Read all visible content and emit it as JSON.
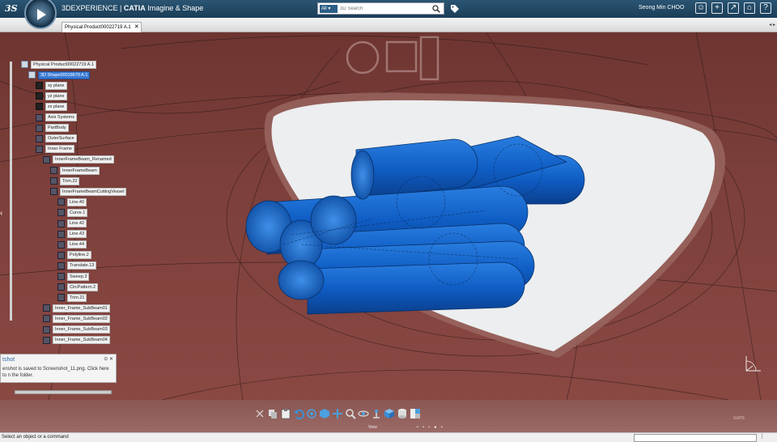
{
  "topbar": {
    "brand": "3DEXPERIENCE | CATIA Imagine & Shape",
    "brand_prefix": "3DEXPERIENCE | ",
    "brand_app": "CATIA",
    "brand_suffix": " Imagine & Shape",
    "search_scope": "All ▾",
    "search_placeholder": "3D Search",
    "user": "Seong Min CHOO",
    "ds_logo": "3S"
  },
  "tabs": [
    {
      "label": "Physical Product00022719 A.1"
    }
  ],
  "tree": {
    "items": [
      {
        "label": "Physical Product00022719 A.1",
        "level": 0,
        "icon": "product-icon"
      },
      {
        "label": "3D Shape00018679 A.1",
        "level": 1,
        "icon": "part-icon",
        "selected": true
      },
      {
        "label": "xy plane",
        "level": 2,
        "icon": "plane-icon"
      },
      {
        "label": "yz plane",
        "level": 2,
        "icon": "plane-icon"
      },
      {
        "label": "zx plane",
        "level": 2,
        "icon": "plane-icon"
      },
      {
        "label": "Axis Systems",
        "level": 2,
        "icon": "axis-system-icon"
      },
      {
        "label": "PartBody",
        "level": 2,
        "icon": "body-icon"
      },
      {
        "label": "OuterSurface",
        "level": 2,
        "icon": "geoset-icon"
      },
      {
        "label": "Inner Frame",
        "level": 2,
        "icon": "geoset-icon"
      },
      {
        "label": "InnerFrameBeam_Renamed",
        "level": 3,
        "icon": "geoset-icon"
      },
      {
        "label": "InnerFrameBeam",
        "level": 4,
        "icon": "surface-icon"
      },
      {
        "label": "Trim.22",
        "level": 4,
        "icon": "trim-icon"
      },
      {
        "label": "InnerFrameBeamCuttingVessel",
        "level": 4,
        "icon": "geoset-icon"
      },
      {
        "label": "Line.40",
        "level": 5,
        "icon": "line-icon"
      },
      {
        "label": "Curve.1",
        "level": 5,
        "icon": "curve-icon"
      },
      {
        "label": "Line.42",
        "level": 5,
        "icon": "line-icon"
      },
      {
        "label": "Line.43",
        "level": 5,
        "icon": "line-icon"
      },
      {
        "label": "Line.44",
        "level": 5,
        "icon": "line-icon"
      },
      {
        "label": "Polyline.2",
        "level": 5,
        "icon": "polyline-icon"
      },
      {
        "label": "Translate.13",
        "level": 5,
        "icon": "translate-icon"
      },
      {
        "label": "Sweep.3",
        "level": 5,
        "icon": "sweep-icon"
      },
      {
        "label": "CircPattern.2",
        "level": 5,
        "icon": "pattern-icon"
      },
      {
        "label": "Trim.21",
        "level": 5,
        "icon": "trim-icon"
      },
      {
        "label": "Inner_Frame_SubBeam01",
        "level": 3,
        "icon": "geoset-icon"
      },
      {
        "label": "Inner_Frame_SubBeam02",
        "level": 3,
        "icon": "geoset-icon"
      },
      {
        "label": "Inner_Frame_SubBeam03",
        "level": 3,
        "icon": "geoset-icon"
      },
      {
        "label": "Inner_Frame_SubBeam04",
        "level": 3,
        "icon": "geoset-icon"
      }
    ]
  },
  "notification": {
    "title": "tshot",
    "message": "enshot is saved to Screenshot_11.png. Click here to n the folder.",
    "controls": "⊙ ✕"
  },
  "actionbar": {
    "section_label": "View",
    "page_dots": "• • • ● •",
    "corner_label": "GXPS"
  },
  "status": {
    "text": "Select an object or a command"
  },
  "colors": {
    "background": "#7a3c38",
    "selection": "#3a7bd5",
    "cylinder_fill": "#1060c8",
    "topbar": "#1f4563"
  }
}
